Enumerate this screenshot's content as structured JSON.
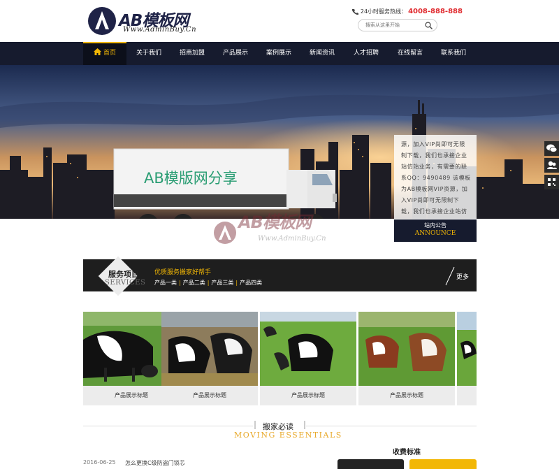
{
  "header": {
    "logo_title": "AB模板网",
    "logo_url": "Www.AdminBuy.Cn",
    "hotline_label": "24小时服务热线：",
    "hotline_number": "4008-888-888",
    "search_placeholder": "搜索从这里开始"
  },
  "nav": {
    "items": [
      {
        "label": "首页",
        "active": true
      },
      {
        "label": "关于我们"
      },
      {
        "label": "招商加盟"
      },
      {
        "label": "产品展示"
      },
      {
        "label": "案例展示"
      },
      {
        "label": "新闻资讯"
      },
      {
        "label": "人才招聘"
      },
      {
        "label": "在线留言"
      },
      {
        "label": "联系我们"
      }
    ]
  },
  "banner": {
    "truck_text": "AB模版网分享"
  },
  "notice": {
    "text": "源，加入VIP尚即可无限制下载，我们也承接企业站仿站业务，有需要的联系QQ：9490489 该模板为AB模板网VIP资源，加入VIP尚即可无限制下载，我们也承接企业站仿",
    "title_cn": "站内公告",
    "title_en": "ANNOUNCE"
  },
  "watermark": {
    "title": "AB模板网",
    "url": "Www.AdminBuy.Cn"
  },
  "services": {
    "title_cn": "服务项目",
    "title_en": "SERVICES",
    "tagline": "优质服务搬家好帮手",
    "categories": [
      "产品一类",
      "产品二类",
      "产品三类",
      "产品四类"
    ],
    "more": "更多"
  },
  "products": [
    {
      "caption": "产品展示标题"
    },
    {
      "caption": "产品展示标题"
    },
    {
      "caption": "产品展示标题"
    },
    {
      "caption": "产品展示标题"
    },
    {
      "caption": ""
    }
  ],
  "essentials": {
    "title_cn": "搬家必读",
    "title_en": "MOVING ESSENTIALS"
  },
  "news": {
    "date": "2016-06-25",
    "title": "怎么更换C级防盗门锁芯"
  },
  "fees": {
    "title": "收费标准"
  },
  "colors": {
    "nav_bg": "#161b2e",
    "accent": "#f2b705",
    "hotline_red": "#e0292d",
    "truck_text_green": "#2a9d73"
  }
}
